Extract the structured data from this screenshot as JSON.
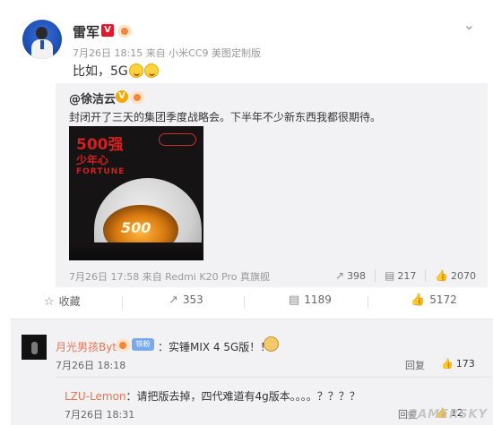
{
  "post": {
    "author": "雷军",
    "time_source": "7月26日 18:15 来自 小米CC9 美图定制版",
    "text": "比如，5G"
  },
  "repost": {
    "author": "@徐洁云",
    "text": "封闭开了三天的集团季度战略会。下半年不少新东西我都很期待。",
    "image": {
      "headline": "500强",
      "subhead": "少年心",
      "tagline": "FORTUNE",
      "number": "500"
    },
    "time_source": "7月26日 17:58 来自 Redmi K20 Pro 真旗舰",
    "reposts": "398",
    "comments": "217",
    "likes": "2070"
  },
  "actions": {
    "favorite": "收藏",
    "repost": "353",
    "comment": "1189",
    "like": "5172"
  },
  "comments": [
    {
      "author": "月光男孩Byte",
      "fan_badge": "铁粉",
      "text": "：实锤MIX 4 5G版！！",
      "time": "7月26日 18:18",
      "reply_label": "回复",
      "likes": "173",
      "sub_reply": {
        "author": "LZU-Lemon",
        "text": "：请把版去掉，四代难道有4g版本。。。。？？？？",
        "time": "7月26日 18:31",
        "reply_label": "回复",
        "likes": "12"
      }
    }
  ],
  "watermark": "GAMERSKY",
  "colors": {
    "accent_orange": "#eb7350",
    "verified_red": "#e6162d",
    "verified_gold": "#f7a800",
    "panel_grey": "#f2f2f5"
  },
  "icons": [
    "chevron-down-icon",
    "star-icon",
    "repost-icon",
    "comment-icon",
    "like-icon"
  ]
}
